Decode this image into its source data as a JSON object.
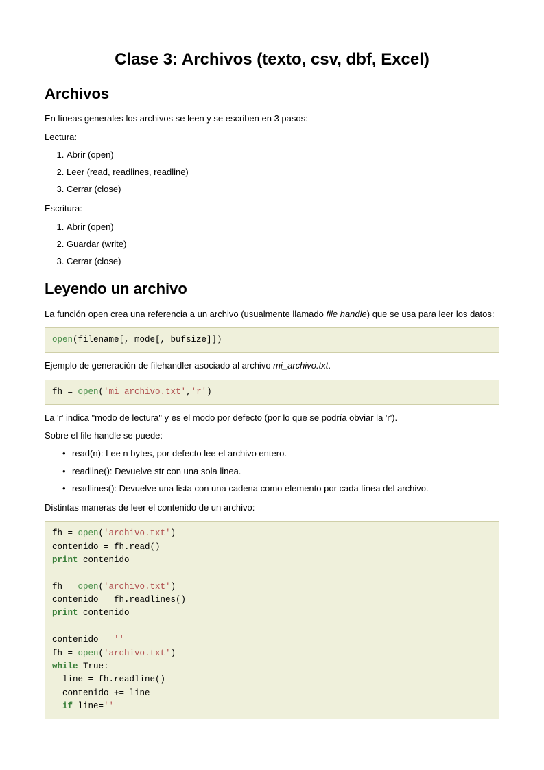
{
  "title": "Clase 3: Archivos (texto, csv, dbf, Excel)",
  "section1": {
    "heading": "Archivos",
    "intro": "En líneas generales los archivos se leen y se escriben en 3 pasos:",
    "lectura_label": "Lectura:",
    "lectura_items": [
      "Abrir (open)",
      "Leer (read, readlines, readline)",
      "Cerrar (close)"
    ],
    "escritura_label": "Escritura:",
    "escritura_items": [
      "Abrir (open)",
      "Guardar (write)",
      "Cerrar (close)"
    ]
  },
  "section2": {
    "heading": "Leyendo un archivo",
    "para1_a": "La función open crea una referencia a un archivo (usualmente llamado ",
    "para1_em": "file handle",
    "para1_b": ") que se usa para leer los datos:",
    "code1": {
      "open": "open",
      "rest": "(filename[, mode[, bufsize]])"
    },
    "para2_a": "Ejemplo de generación de filehandler asociado al archivo ",
    "para2_em": "mi_archivo.txt",
    "para2_b": ".",
    "code2": {
      "pre": "fh = ",
      "open": "open",
      "paren1": "(",
      "str1": "'mi_archivo.txt'",
      "comma": ",",
      "str2": "'r'",
      "paren2": ")"
    },
    "para3": "La 'r' indica \"modo de lectura\" y es el modo por defecto (por lo que se podría obviar la 'r').",
    "para4": "Sobre el file handle se puede:",
    "methods": [
      "read(n): Lee n bytes, por defecto lee el archivo entero.",
      "readline(): Devuelve str con una sola linea.",
      "readlines(): Devuelve una lista con una cadena como elemento por cada línea del archivo."
    ],
    "para5": "Distintas maneras de leer el contenido de un archivo:",
    "code3": {
      "l1a": "fh = ",
      "l1_open": "open",
      "l1b": "(",
      "l1_str": "'archivo.txt'",
      "l1c": ")",
      "l2": "contenido = fh.read()",
      "l3_kw": "print",
      "l3b": " contenido",
      "blank1": "",
      "l4a": "fh = ",
      "l4_open": "open",
      "l4b": "(",
      "l4_str": "'archivo.txt'",
      "l4c": ")",
      "l5": "contenido = fh.readlines()",
      "l6_kw": "print",
      "l6b": " contenido",
      "blank2": "",
      "l7a": "contenido = ",
      "l7_str": "''",
      "l8a": "fh = ",
      "l8_open": "open",
      "l8b": "(",
      "l8_str": "'archivo.txt'",
      "l8c": ")",
      "l9_kw": "while",
      "l9b": " True:",
      "l10": "  line = fh.readline()",
      "l11": "  contenido += line",
      "l12a": "  ",
      "l12_kw": "if",
      "l12b": " line=",
      "l12_str": "''"
    }
  }
}
